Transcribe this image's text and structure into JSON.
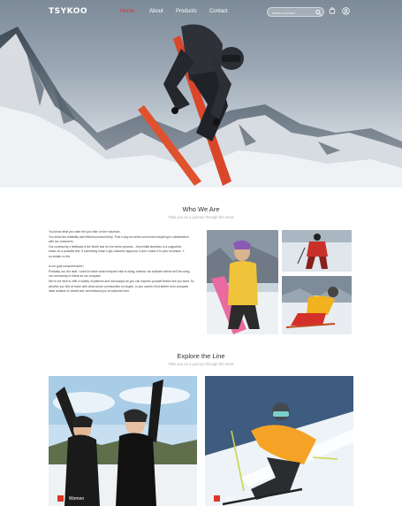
{
  "nav": {
    "logo": "TSYKOO",
    "links": [
      {
        "label": "Home",
        "active": true
      },
      {
        "label": "About",
        "active": false
      },
      {
        "label": "Products",
        "active": false
      },
      {
        "label": "Contact",
        "active": false
      }
    ],
    "search_placeholder": "search a product",
    "icons": [
      "search-icon",
      "cart-icon",
      "user-icon"
    ],
    "accent": "#e0342a"
  },
  "who": {
    "title": "Who We Are",
    "subtitle": "Take you on a journey through the snow",
    "lines": [
      "You know what you want the your bike on the mountain.",
      "   You share the reliability and efficient product beep. That   s why we select and build everything in  collaboration",
      "with our customers.",
      "Our community   s feedback is the North star for the entire process – from initial sketches to a supportive",
      "tracks on a possible test. It something mean   s get customer approval, it won   t make it to your mountain.   Y",
      "ou simple on the",
      "",
      "   is our goal   comprehensive   !",
      "   Probably not, the deal.   I want to follow what everyone else is doing, instead, we cultivate where we’ll be using",
      "our community of riders as our compass.",
      "We’re not here to offer a variety of patterns and colourways as you can express yourself before see you want. So",
      "whether you find at home with clean stone communities on slopes, or you couldn   t find farther from computer",
      "   ideal   creative of   overall   and   conventional   you   re welcome here."
    ]
  },
  "explore": {
    "title": "Explore the Line",
    "subtitle": "Take you on a journey through the snow",
    "cards": [
      {
        "label": "Women"
      },
      {
        "label": "Men"
      }
    ]
  }
}
